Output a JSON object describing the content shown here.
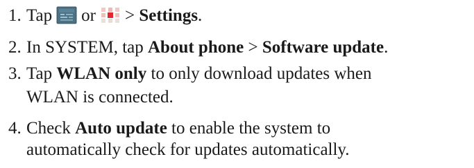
{
  "steps": [
    {
      "number": "1.",
      "text_a": "Tap",
      "icon_1": "settings-app-icon",
      "text_or": "or",
      "icon_2": "apps-grid-icon",
      "text_arrow": ">",
      "bold_settings": "Settings",
      "text_end": "."
    },
    {
      "number": "2.",
      "text_a": "In SYSTEM, tap",
      "bold_about": "About phone",
      "text_arrow": ">",
      "bold_update": "Software update",
      "text_end": "."
    },
    {
      "number": "3.",
      "text_a": "Tap",
      "bold_wlan": "WLAN only",
      "text_b": "to only download updates when",
      "line2": "WLAN is connected."
    },
    {
      "number": "4.",
      "text_a": "Check",
      "bold_auto": "Auto update",
      "text_b": "to enable the system to",
      "line2": "automatically check for updates automatically."
    }
  ],
  "colors": {
    "settings_icon_bg": "#3e5f70",
    "apps_icon_red": "#e0282e"
  }
}
